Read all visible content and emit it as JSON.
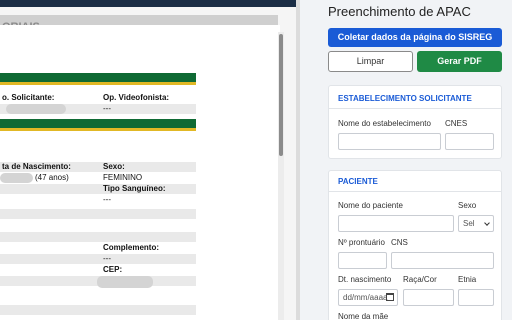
{
  "sisreg": {
    "section_title": "ORIAIS",
    "rows": [
      {
        "a": "o. Solicitante:",
        "b": "Op. Videofonista:"
      },
      {
        "a": "",
        "b": "---"
      },
      {
        "a": "ta de Nascimento:",
        "b": "Sexo:"
      },
      {
        "a": "(47 anos)",
        "b": "FEMININO"
      },
      {
        "a": "",
        "b": "Tipo Sanguíneo:"
      },
      {
        "a": "",
        "b": "---"
      },
      {
        "a": "",
        "b": "Complemento:"
      },
      {
        "a": "",
        "b": "---"
      },
      {
        "a": "",
        "b": "CEP:"
      }
    ]
  },
  "panel": {
    "title": "Preenchimento de APAC",
    "buttons": {
      "coletar": "Coletar dados da página do SISREG",
      "limpar": "Limpar",
      "gerar_pdf": "Gerar PDF"
    },
    "estabelecimento": {
      "title": "ESTABELECIMENTO SOLICITANTE",
      "nome_label": "Nome do estabelecimento",
      "cnes_label": "CNES"
    },
    "paciente": {
      "title": "PACIENTE",
      "nome_label": "Nome do paciente",
      "sexo_label": "Sexo",
      "sexo_value": "Sel",
      "prontuario_label": "Nº prontuário",
      "cns_label": "CNS",
      "nascimento_label": "Dt. nascimento",
      "nascimento_placeholder": "dd/mm/aaaa",
      "raca_label": "Raça/Cor",
      "etnia_label": "Etnia",
      "mae_label": "Nome da mãe"
    }
  },
  "colors": {
    "accent": "#1a5bd6",
    "success": "#1f8a45",
    "sisreg_green": "#0f6a34",
    "sisreg_gold": "#e1b825"
  }
}
